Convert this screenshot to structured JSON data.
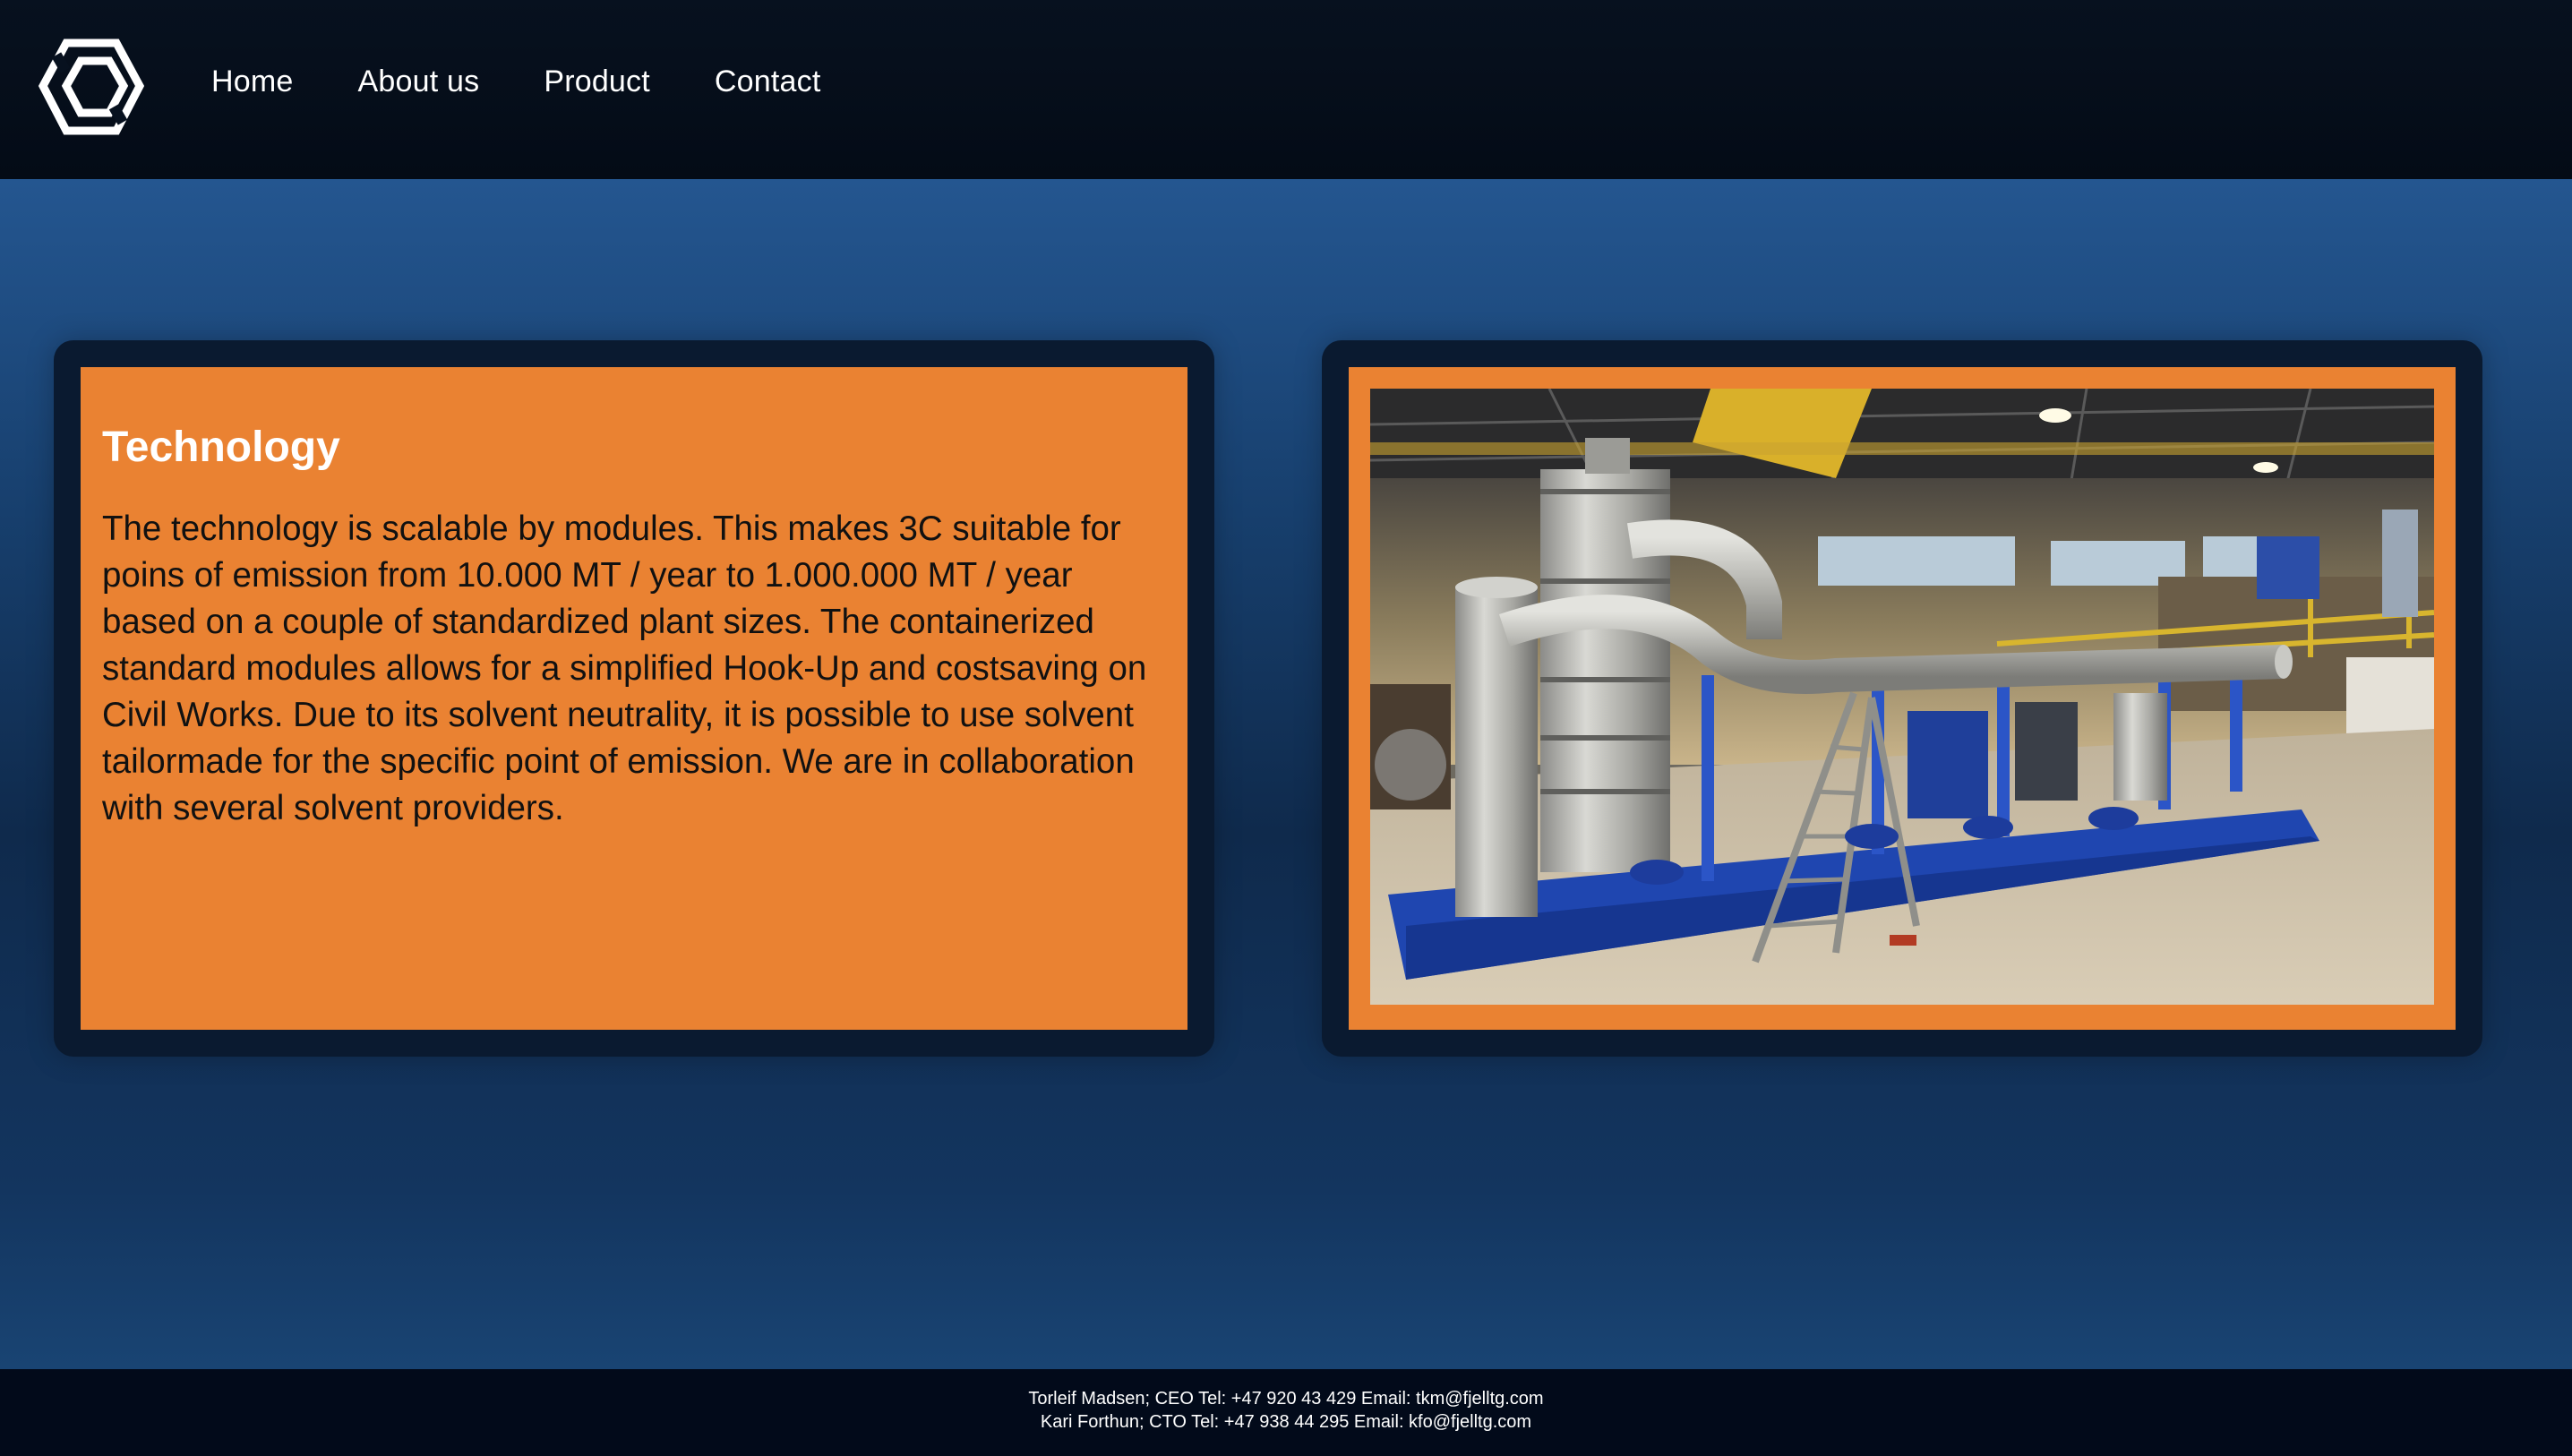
{
  "nav": {
    "logo_icon": "hexagon-logo-icon",
    "items": [
      {
        "label": "Home"
      },
      {
        "label": "About us"
      },
      {
        "label": "Product"
      },
      {
        "label": "Contact"
      }
    ]
  },
  "technology": {
    "title": "Technology",
    "body": "The technology is scalable by modules. This makes 3C suitable for poins of emission from 10.000 MT / year to 1.000.000 MT / year based on a couple of standardized plant sizes. The containerized standard modules allows for a simplified Hook-Up and costsaving on Civil Works. Due to its solvent neutrality, it is possible to use solvent tailormade for the specific point of emission. We are in collaboration with several solvent providers."
  },
  "footer": {
    "line1": "Torleif Madsen; CEO Tel: +47 920 43 429 Email: tkm@fjelltg.com",
    "line2": "Kari Forthun; CTO Tel: +47 938 44 295 Email: kfo@fjelltg.com"
  },
  "colors": {
    "accent_orange": "#ea8232",
    "header_bg": "#07111f",
    "main_blue": "#245690",
    "card_dark": "#0a1a30"
  }
}
